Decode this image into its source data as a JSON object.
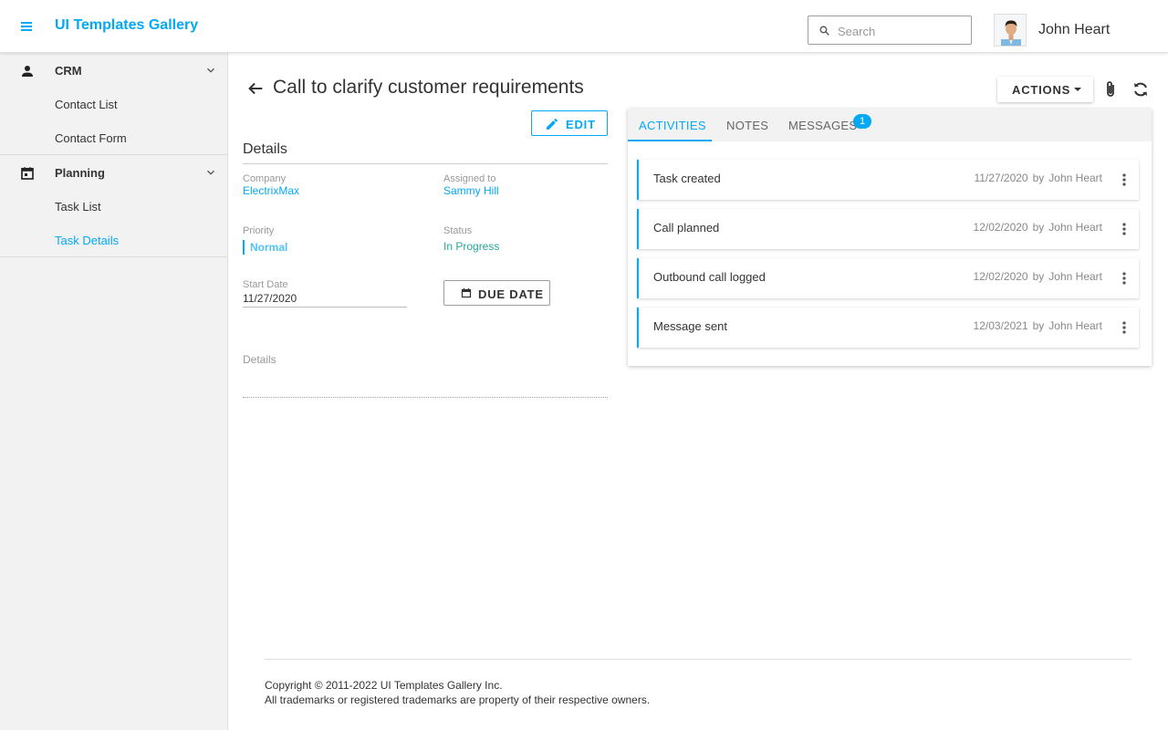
{
  "header": {
    "app_title": "UI Templates Gallery",
    "search_placeholder": "Search",
    "user_name": "John Heart",
    "menu_icon": "hamburger-menu-icon",
    "search_icon": "search-icon"
  },
  "sidebar": {
    "groups": [
      {
        "label": "CRM",
        "icon": "person-icon",
        "items": [
          {
            "label": "Contact List"
          },
          {
            "label": "Contact Form"
          }
        ]
      },
      {
        "label": "Planning",
        "icon": "calendar-icon",
        "items": [
          {
            "label": "Task List"
          },
          {
            "label": "Task Details",
            "active": true
          }
        ]
      }
    ]
  },
  "page": {
    "title": "Call to clarify customer requirements",
    "actions_label": "ACTIONS"
  },
  "details": {
    "edit_label": "EDIT",
    "section_title": "Details",
    "company_label": "Company",
    "company_value": "ElectrixMax",
    "assigned_label": "Assigned to",
    "assigned_value": "Sammy Hill",
    "priority_label": "Priority",
    "priority_value": "Normal",
    "status_label": "Status",
    "status_value": "In Progress",
    "start_date_label": "Start Date",
    "start_date_value": "11/27/2020",
    "due_date_label": "DUE DATE",
    "details_label": "Details"
  },
  "tabs": [
    {
      "label": "ACTIVITIES",
      "active": true
    },
    {
      "label": "NOTES"
    },
    {
      "label": "MESSAGES",
      "badge": "1"
    }
  ],
  "activities": [
    {
      "title": "Task created",
      "date": "11/27/2020",
      "by": "by",
      "author": "John Heart"
    },
    {
      "title": "Call planned",
      "date": "12/02/2020",
      "by": "by",
      "author": "John Heart"
    },
    {
      "title": "Outbound call logged",
      "date": "12/02/2020",
      "by": "by",
      "author": "John Heart"
    },
    {
      "title": "Message sent",
      "date": "12/03/2021",
      "by": "by",
      "author": "John Heart"
    }
  ],
  "footer": {
    "copyright": "Copyright © 2011-2022 UI Templates Gallery Inc.",
    "trademarks": "All trademarks or registered trademarks are property of their respective owners."
  },
  "colors": {
    "accent": "#03a9f4",
    "status": "#26a69a",
    "sidebar_bg": "#f2f2f2"
  }
}
